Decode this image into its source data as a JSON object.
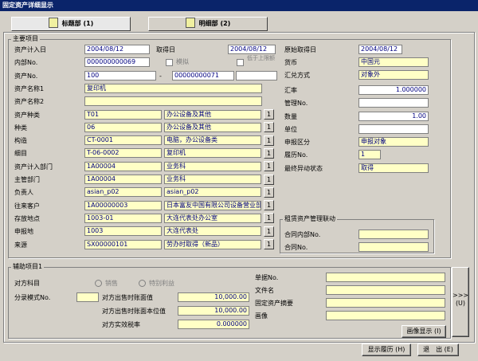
{
  "window": {
    "title": "固定资产详细显示"
  },
  "tabs": [
    {
      "label": "标题部 (1)"
    },
    {
      "label": "明细部 (2)"
    }
  ],
  "main": {
    "group_label": "主要项目",
    "rows": [
      {
        "label": "资产计入日",
        "code": "2004/08/12"
      },
      {
        "label": "内部No.",
        "code": "000000000069"
      },
      {
        "label": "资产No.",
        "code": "100"
      },
      {
        "label": "资产名称1",
        "code": "复印机"
      },
      {
        "label": "资产名称2",
        "code": ""
      },
      {
        "label": "资产种类",
        "code": "T01",
        "name": "办公设备及其他",
        "btn": "1"
      },
      {
        "label": "种类",
        "code": "06",
        "name": "办公设备及其他",
        "btn": "1"
      },
      {
        "label": "构造",
        "code": "CT-0001",
        "name": "电脑，办公设备类",
        "btn": "1"
      },
      {
        "label": "细目",
        "code": "T-06-0002",
        "name": "复印机",
        "btn": "1"
      },
      {
        "label": "资产计入部门",
        "code": "1A00004",
        "name": "业务科",
        "btn": "1"
      },
      {
        "label": "主管部门",
        "code": "1A00004",
        "name": "业务科",
        "btn": "1"
      },
      {
        "label": "负责人",
        "code": "asian_p02",
        "name": "asian_p02",
        "btn": "1"
      },
      {
        "label": "往来客户",
        "code": "1A00000003",
        "name": "日本富友中国有限公司设备营业部",
        "btn": "1"
      },
      {
        "label": "存放地点",
        "code": "1003-01",
        "name": "大连代表处办公室",
        "btn": "1"
      },
      {
        "label": "申报地",
        "code": "1003",
        "name": "大连代表处",
        "btn": "1"
      },
      {
        "label": "来源",
        "code": "SX00000101",
        "name": "劳办时取得（新品）",
        "btn": "1"
      }
    ],
    "acquire_label": "取得日",
    "acquire_date": "2004/08/12",
    "mock_label": "模拟",
    "lower_limit_label": "低于上限额",
    "asset_no_sep": "-",
    "asset_no_suffix": "00000000071",
    "right": [
      {
        "label": "原始取得日",
        "value": "2004/08/12"
      },
      {
        "label": "货币",
        "value": "中国元"
      },
      {
        "label": "汇兑方式",
        "value": "对象外"
      },
      {
        "label": "汇率",
        "value": "1.000000"
      },
      {
        "label": "管理No.",
        "value": ""
      },
      {
        "label": "数量",
        "value": "1.00"
      },
      {
        "label": "单位",
        "value": ""
      },
      {
        "label": "申报区分",
        "value": "申报对象"
      },
      {
        "label": "履历No.",
        "value": "1"
      },
      {
        "label": "最终异动状态",
        "value": "取得"
      }
    ],
    "lease": {
      "group_label": "租赁资产管理联动",
      "contract_inner_label": "合同内部No.",
      "contract_inner_value": "",
      "contract_label": "合同No.",
      "contract_value": ""
    }
  },
  "aux": {
    "group_label": "辅助项目1",
    "counter_label": "对方科目",
    "radio1": "销售",
    "radio2": "特别利益",
    "split_label": "分录模式No.",
    "split_value": "",
    "amount_label": "对方出售时账面值",
    "amount_value": "10,000.00",
    "amount_local_label": "对方出售时账面本位值",
    "amount_local_value": "10,000.00",
    "tax_label": "对方实效税率",
    "tax_value": "0.000000",
    "slip_label": "单据No.",
    "slip_value": "",
    "file_label": "文件名",
    "file_value": "",
    "summary_label": "固定资产摘要",
    "summary_value": "",
    "image_label": "画像",
    "image_value": "",
    "image_button": "画像显示 (I)",
    "next_top": ">>>",
    "next_bottom": "(U)"
  },
  "footer": {
    "history_button": "显示履历 (H)",
    "exit_button": "退　出 (E)"
  }
}
